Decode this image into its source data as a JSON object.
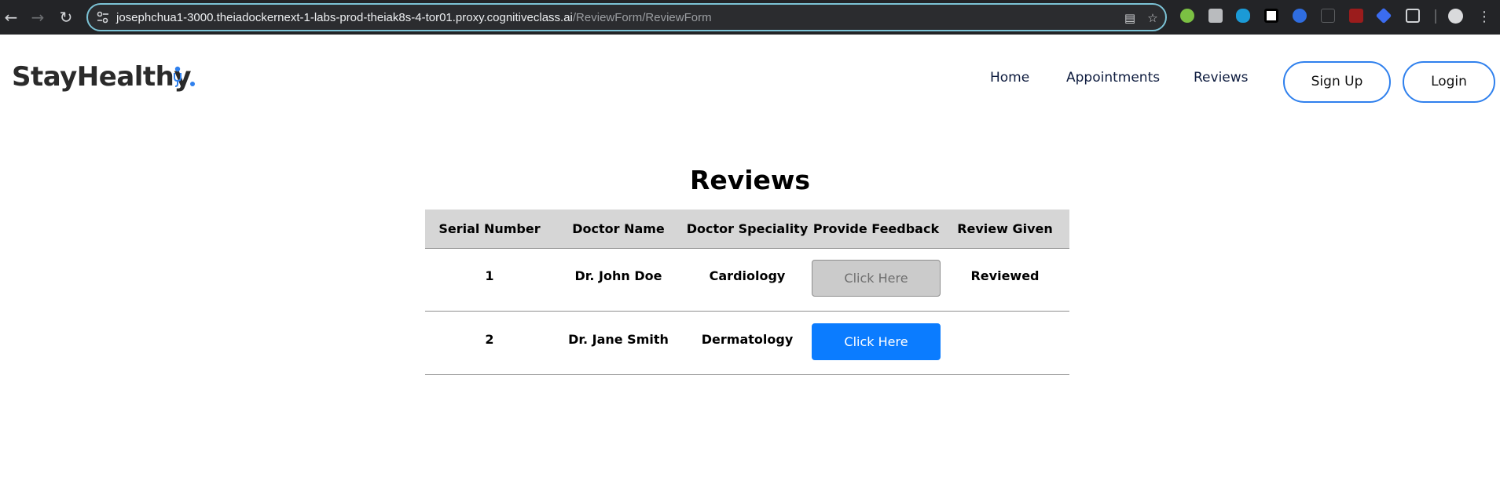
{
  "browser": {
    "url_host": "josephchua1-3000.theiadockernext-1-labs-prod-theiak8s-4-tor01.proxy.cognitiveclass.ai",
    "url_path": "/ReviewForm/ReviewForm",
    "icons": [
      "back-arrow-icon",
      "forward-arrow-icon",
      "reload-icon",
      "site-info-icon",
      "install-app-icon",
      "bookmark-star-icon",
      "extensions-puzzle-icon",
      "profile-avatar-icon",
      "more-menu-icon"
    ]
  },
  "header": {
    "logo_text": "StayHealthy",
    "nav": [
      "Home",
      "Appointments",
      "Reviews"
    ],
    "signup_label": "Sign Up",
    "login_label": "Login",
    "accent_color": "#2f80ed"
  },
  "reviews": {
    "title": "Reviews",
    "columns": [
      "Serial Number",
      "Doctor Name",
      "Doctor Speciality",
      "Provide Feedback",
      "Review Given"
    ],
    "rows": [
      {
        "serial": "1",
        "doctor": "Dr. John Doe",
        "speciality": "Cardiology",
        "feedback_label": "Click Here",
        "feedback_state": "disabled",
        "review_given": "Reviewed"
      },
      {
        "serial": "2",
        "doctor": "Dr. Jane Smith",
        "speciality": "Dermatology",
        "feedback_label": "Click Here",
        "feedback_state": "enabled",
        "review_given": ""
      }
    ],
    "button_colors": {
      "enabled": "#0b7cff",
      "disabled": "#cbcbcb"
    }
  }
}
